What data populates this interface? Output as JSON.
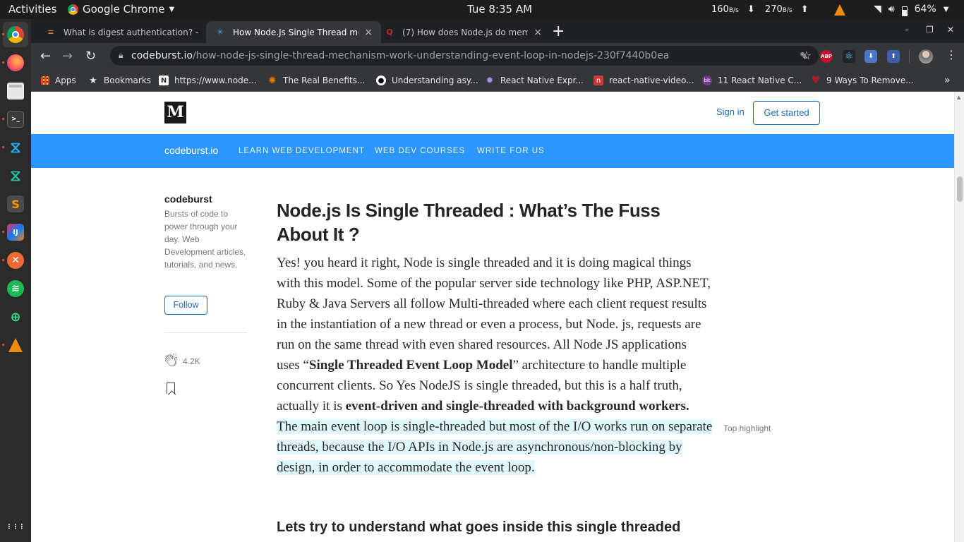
{
  "system": {
    "activities": "Activities",
    "app_name": "Google Chrome",
    "clock": "Tue  8:35 AM",
    "net_down": "160",
    "net_down_unit": "B/s",
    "net_up": "270",
    "net_up_unit": "B/s",
    "battery": "64%"
  },
  "dock": {
    "items": [
      "chrome-icon",
      "firefox-icon",
      "files-icon",
      "terminal-icon",
      "vscode-icon",
      "vscode-insiders-icon",
      "sublime-text-icon",
      "intellij-icon",
      "compass-icon",
      "spotify-icon",
      "android-studio-icon",
      "vlc-icon"
    ],
    "show_apps": "⋮⋮⋮"
  },
  "tabs": [
    {
      "title": "What is digest authentication? - ",
      "favicon": "stackoverflow-icon",
      "close": "×"
    },
    {
      "title": "How Node.Js Single Thread mec",
      "favicon": "codeburst-icon",
      "close": "×"
    },
    {
      "title": "(7) How does Node.js do memor",
      "favicon": "quora-icon",
      "close": "×"
    }
  ],
  "new_tab": "+",
  "window_controls": {
    "minimize": "–",
    "maximize": "❐",
    "close": "✕"
  },
  "toolbar": {
    "url_host": "codeburst.io",
    "url_path": "/how-node-js-single-thread-mechanism-work-understanding-event-loop-in-nodejs-230f7440b0ea"
  },
  "extensions": [
    {
      "name": "eyedropper-icon",
      "label": "✎",
      "color": "#35363a"
    },
    {
      "name": "adblock-plus-icon",
      "label": "ABP",
      "color": "#c70d2c"
    },
    {
      "name": "react-devtools-icon",
      "label": "⚛",
      "color": "#35363a"
    },
    {
      "name": "extension-download-icon",
      "label": "⬇",
      "color": "#4a78c2"
    },
    {
      "name": "extension-upload-icon",
      "label": "⬆",
      "color": "#3b5fa8"
    }
  ],
  "bookmarks": [
    {
      "label": "Apps",
      "icon": "apps-grid-icon"
    },
    {
      "label": "Bookmarks",
      "icon": "star-icon"
    },
    {
      "label": "https://www.node...",
      "icon": "nodejs-icon"
    },
    {
      "label": "The Real Benefits...",
      "icon": "site-icon"
    },
    {
      "label": "Understanding asy...",
      "icon": "github-icon"
    },
    {
      "label": "React Native Expr...",
      "icon": "react-native-icon"
    },
    {
      "label": "react-native-video...",
      "icon": "npm-icon"
    },
    {
      "label": "11 React Native C...",
      "icon": "bit-icon"
    },
    {
      "label": "9 Ways To Remove...",
      "icon": "heart-icon"
    }
  ],
  "bookmarks_more": "»",
  "site": {
    "logo": "M",
    "sign_in": "Sign in",
    "get_started": "Get started",
    "pub_logo": "codeburst.io",
    "nav": [
      "LEARN WEB DEVELOPMENT",
      "WEB DEV COURSES",
      "WRITE FOR US"
    ]
  },
  "sidebar": {
    "name": "codeburst",
    "description": "Bursts of code to power through your day. Web Development articles, tutorials, and news.",
    "follow": "Follow",
    "claps": "4.2K"
  },
  "article": {
    "title": "Node.js Is Single Threaded : What’s The Fuss About It ?",
    "p1": "Yes! you heard it right, Node is single threaded and it is doing magical things with this model. Some of the popular server side technology like PHP, ASP.NET, Ruby & Java Servers all follow Multi-threaded where each client request results in the instantiation of a new thread or even a process, but Node. js, requests are run on the same thread with even shared resources. All Node JS applications uses “",
    "b1": "Single Threaded Event Loop Model",
    "p2": "” architecture to handle multiple concurrent clients. So Yes NodeJS is single threaded, but this is a half truth, actually it is ",
    "b2": "event-driven and single-threaded with background workers.",
    "p3": " ",
    "highlight": "The main event loop is single-threaded but most of the I/O works run on separate threads, because the I/O APIs in Node.js are asynchronous/non-blocking by design, in order to accommodate the event loop.",
    "top_highlight": "Top highlight",
    "subheading": "Lets try to understand what goes inside this single threaded"
  }
}
